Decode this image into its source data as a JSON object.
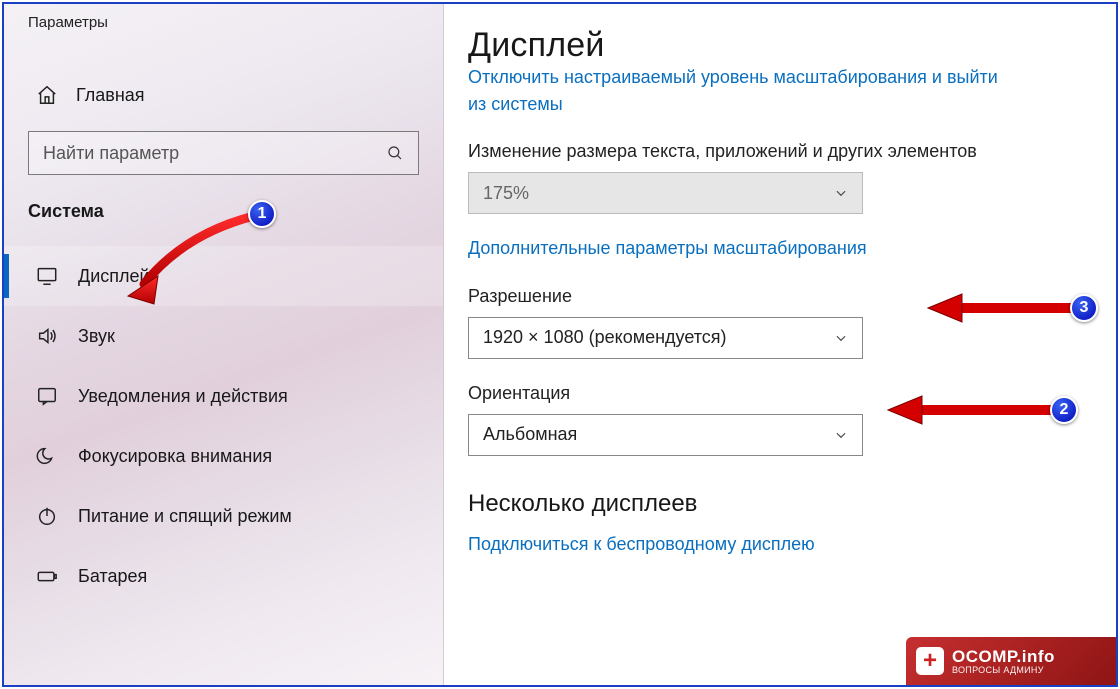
{
  "app_title": "Параметры",
  "sidebar": {
    "home_label": "Главная",
    "search_placeholder": "Найти параметр",
    "section_title": "Система",
    "items": [
      {
        "label": "Дисплей"
      },
      {
        "label": "Звук"
      },
      {
        "label": "Уведомления и действия"
      },
      {
        "label": "Фокусировка внимания"
      },
      {
        "label": "Питание и спящий режим"
      },
      {
        "label": "Батарея"
      }
    ]
  },
  "main": {
    "page_title": "Дисплей",
    "truncated_link_top": "Отключить настраиваемый уровень масштабирования и выйти",
    "truncated_link_bottom": "из системы",
    "scale_label": "Изменение размера текста, приложений и других элементов",
    "scale_value": "175%",
    "advanced_scaling_link": "Дополнительные параметры масштабирования",
    "resolution_label": "Разрешение",
    "resolution_value": "1920 × 1080 (рекомендуется)",
    "orientation_label": "Ориентация",
    "orientation_value": "Альбомная",
    "multi_heading": "Несколько дисплеев",
    "wireless_link": "Подключиться к беспроводному дисплею"
  },
  "badges": {
    "b1": "1",
    "b2": "2",
    "b3": "3"
  },
  "watermark": {
    "main": "OCOMP.info",
    "sub": "вопросы админу"
  }
}
